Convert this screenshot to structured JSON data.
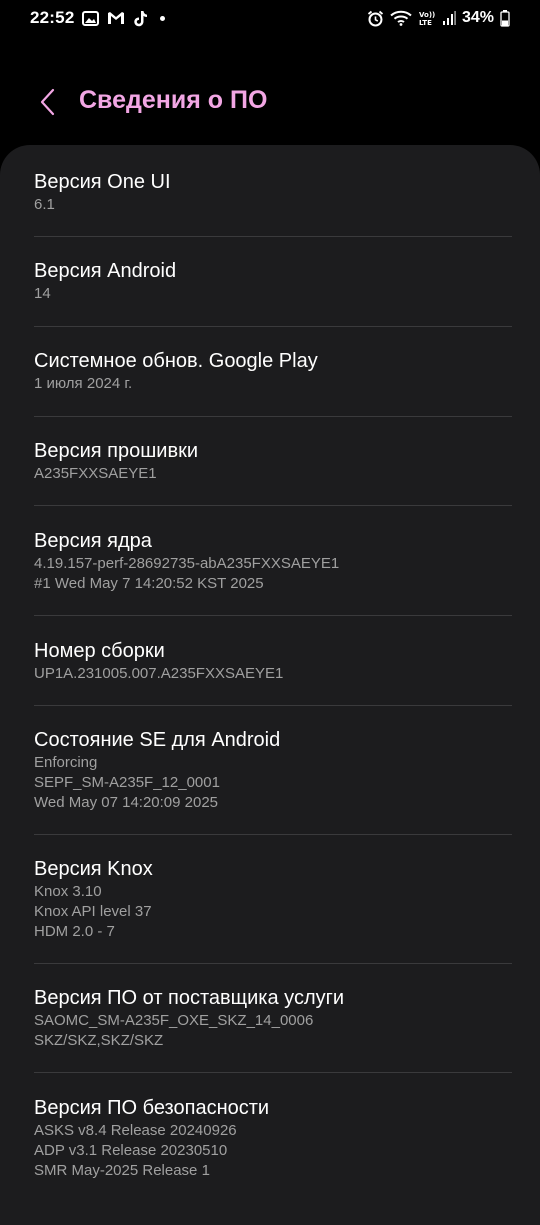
{
  "status_bar": {
    "time": "22:52",
    "battery": "34%",
    "network": "LTE",
    "icons": [
      "gallery-icon",
      "gmail-icon",
      "tiktok-icon",
      "notification-dot",
      "alarm-icon",
      "wifi-icon",
      "volte-lte-icon",
      "signal-icon",
      "battery-icon"
    ]
  },
  "header": {
    "title": "Сведения о ПО",
    "back_icon": "chevron-left-icon"
  },
  "colors": {
    "background": "#000000",
    "card": "#1c1c1e",
    "title_accent": "#f2a6e4",
    "secondary_text": "#a0a0a0",
    "divider": "#3a3a3c"
  },
  "items": [
    {
      "title": "Версия One UI",
      "lines": [
        "6.1"
      ]
    },
    {
      "title": "Версия Android",
      "lines": [
        "14"
      ]
    },
    {
      "title": "Системное обнов. Google Play",
      "lines": [
        "1 июля 2024 г."
      ]
    },
    {
      "title": "Версия прошивки",
      "lines": [
        "A235FXXSAEYE1"
      ]
    },
    {
      "title": "Версия ядра",
      "lines": [
        "4.19.157-perf-28692735-abA235FXXSAEYE1",
        "#1 Wed May 7 14:20:52 KST 2025"
      ]
    },
    {
      "title": "Номер сборки",
      "lines": [
        "UP1A.231005.007.A235FXXSAEYE1"
      ]
    },
    {
      "title": "Состояние SE для Android",
      "lines": [
        "Enforcing",
        "SEPF_SM-A235F_12_0001",
        "Wed May 07 14:20:09 2025"
      ]
    },
    {
      "title": "Версия Knox",
      "lines": [
        "Knox 3.10",
        "Knox API level 37",
        "HDM 2.0 - 7"
      ]
    },
    {
      "title": "Версия ПО от поставщика услуги",
      "lines": [
        "SAOMC_SM-A235F_OXE_SKZ_14_0006",
        "SKZ/SKZ,SKZ/SKZ"
      ]
    },
    {
      "title": "Версия ПО безопасности",
      "lines": [
        "ASKS v8.4 Release 20240926",
        "ADP v3.1 Release 20230510",
        "SMR May-2025 Release 1"
      ]
    }
  ]
}
